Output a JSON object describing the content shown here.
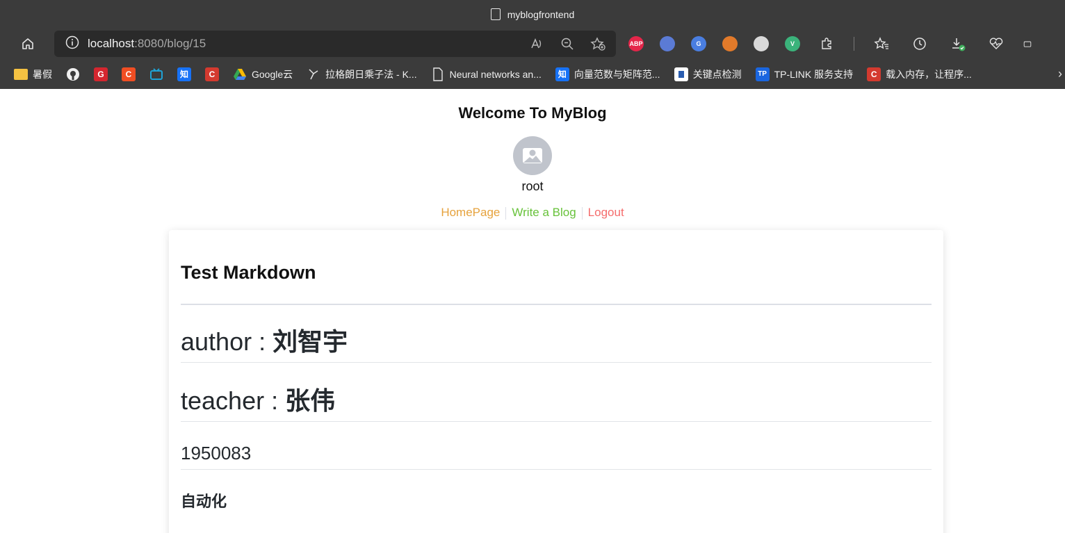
{
  "browser": {
    "tab_title": "myblogfrontend",
    "url_host": "localhost",
    "url_rest": ":8080/blog/15",
    "extensions": [
      {
        "name": "abp-icon",
        "label": "ABP",
        "color": "#e4264a"
      },
      {
        "name": "bird-extension-icon",
        "label": "",
        "color": "#5b7bd5"
      },
      {
        "name": "google-translate-icon",
        "label": "G",
        "color": "#4a7ee0"
      },
      {
        "name": "tiger-extension-icon",
        "label": "",
        "color": "#e27a2a"
      },
      {
        "name": "shield-extension-icon",
        "label": "",
        "color": "#d9d9d9"
      },
      {
        "name": "vue-devtools-icon",
        "label": "V",
        "color": "#3bb37b"
      }
    ],
    "bookmarks": [
      {
        "name": "bookmark-folder",
        "label": "暑假",
        "icon": "folder",
        "color": "#f5c242"
      },
      {
        "name": "bookmark-github",
        "label": "",
        "icon": "github",
        "color": "#3b3b3b"
      },
      {
        "name": "bookmark-g",
        "label": "",
        "icon": "G",
        "color": "#d4262f"
      },
      {
        "name": "bookmark-c1",
        "label": "",
        "icon": "C",
        "color": "#f04e23"
      },
      {
        "name": "bookmark-bilibili",
        "label": "",
        "icon": "tv",
        "color": "#1fa3d6"
      },
      {
        "name": "bookmark-zhihu",
        "label": "",
        "icon": "知",
        "color": "#1772f6"
      },
      {
        "name": "bookmark-c2",
        "label": "",
        "icon": "C",
        "color": "#d43a2f"
      },
      {
        "name": "bookmark-google-cloud",
        "label": "Google云",
        "icon": "drive",
        "color": "#34a853"
      },
      {
        "name": "bookmark-lagrange",
        "label": "拉格朗日乘子法 - K...",
        "icon": "link",
        "color": "#3b3b3b"
      },
      {
        "name": "bookmark-neural",
        "label": "Neural networks an...",
        "icon": "doc",
        "color": "#3b3b3b"
      },
      {
        "name": "bookmark-zhihu-norm",
        "label": "向量范数与矩阵范...",
        "icon": "知",
        "color": "#1772f6"
      },
      {
        "name": "bookmark-keypoint",
        "label": "关键点检测",
        "icon": "img",
        "color": "#ffffff"
      },
      {
        "name": "bookmark-tplink",
        "label": "TP-LINK 服务支持",
        "icon": "TP",
        "color": "#1a66e0"
      },
      {
        "name": "bookmark-memory",
        "label": "载入内存，让程序...",
        "icon": "C",
        "color": "#d43a2f"
      }
    ]
  },
  "header": {
    "welcome": "Welcome To MyBlog",
    "username": "root"
  },
  "nav": {
    "home": "HomePage",
    "write": "Write a Blog",
    "logout": "Logout"
  },
  "blog": {
    "title": "Test Markdown",
    "author_label": "author : ",
    "author_name": "刘智宇",
    "teacher_label": "teacher : ",
    "teacher_name": "张伟",
    "student_id": "1950083",
    "major": "自动化"
  }
}
